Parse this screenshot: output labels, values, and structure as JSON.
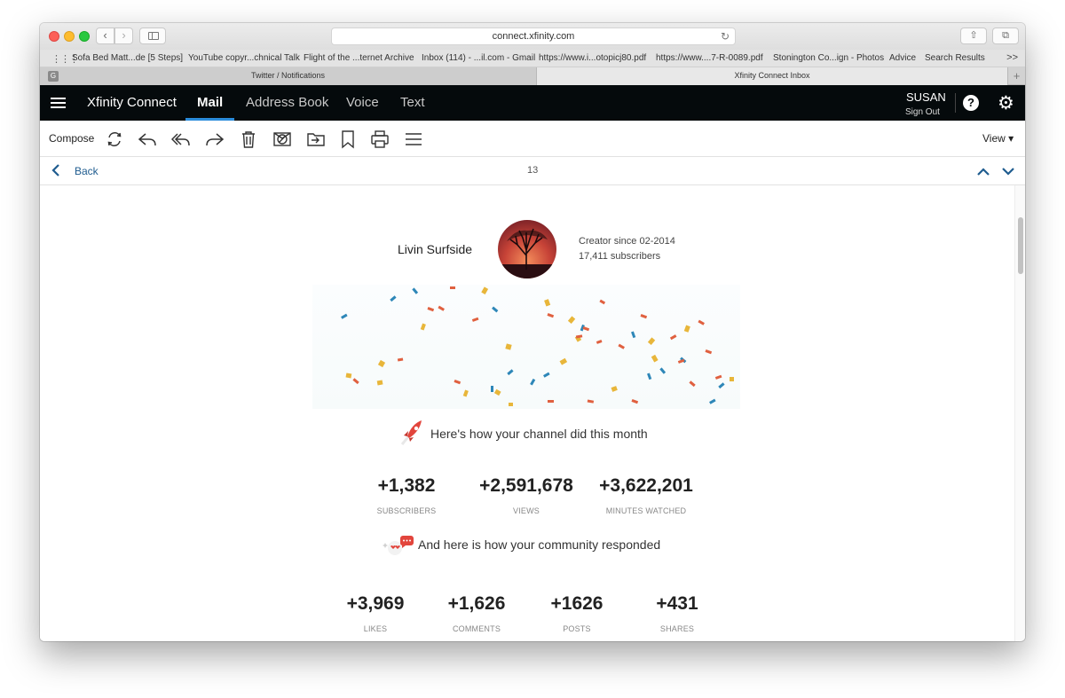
{
  "browser": {
    "url": "connect.xfinity.com",
    "bookmarks": [
      "Sofa Bed Matt...de [5 Steps]",
      "YouTube copyr...chnical Talk",
      "Flight of the ...ternet Archive",
      "Inbox (114) - ...il.com - Gmail",
      "https://www.i...otopicj80.pdf",
      "https://www....7-R-0089.pdf",
      "Stonington Co...ign - Photos",
      "Advice",
      "Search Results"
    ],
    "bookmarks_more": ">>",
    "tabs": [
      {
        "label": "Twitter / Notifications",
        "favicon": "G"
      },
      {
        "label": "Xfinity Connect Inbox"
      }
    ],
    "new_tab": "+"
  },
  "app": {
    "brand": "Xfinity Connect",
    "nav": [
      "Mail",
      "Address Book",
      "Voice",
      "Text"
    ],
    "user": "SUSAN",
    "sign_out": "Sign Out",
    "help": "?"
  },
  "toolbar": {
    "compose": "Compose",
    "view": "View ▾",
    "icons": [
      "refresh-icon",
      "reply-icon",
      "reply-all-icon",
      "forward-icon",
      "trash-icon",
      "junk-icon",
      "move-icon",
      "flag-icon",
      "print-icon",
      "more-icon"
    ]
  },
  "message_nav": {
    "back": "Back",
    "count": "13"
  },
  "email": {
    "channel_name": "Livin Surfside",
    "creator_since": "Creator since 02-2014",
    "subscribers": "17,411 subscribers",
    "section1_title": "Here's how your channel did this month",
    "section1_stats": [
      {
        "value": "+1,382",
        "label": "SUBSCRIBERS"
      },
      {
        "value": "+2,591,678",
        "label": "VIEWS"
      },
      {
        "value": "+3,622,201",
        "label": "MINUTES WATCHED"
      }
    ],
    "section2_title": "And here is how your community responded",
    "section2_stats": [
      {
        "value": "+3,969",
        "label": "LIKES"
      },
      {
        "value": "+1,626",
        "label": "COMMENTS"
      },
      {
        "value": "+1626",
        "label": "POSTS"
      },
      {
        "value": "+431",
        "label": "SHARES"
      }
    ]
  },
  "colors": {
    "appbar": "#050a0c",
    "accent": "#2b8cdb",
    "link": "#1f5c8f",
    "confetti": [
      "#e8b63a",
      "#2e87b8",
      "#e0603f"
    ]
  }
}
